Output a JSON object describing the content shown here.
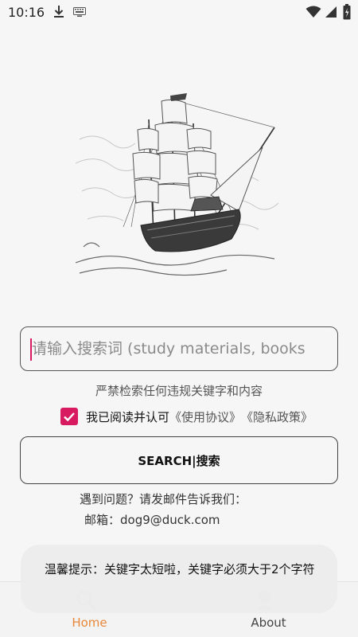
{
  "status_bar": {
    "time": "10:16",
    "icons": [
      "download-icon",
      "keyboard-icon",
      "wifi-icon",
      "signal-icon",
      "battery-icon"
    ]
  },
  "illustration": {
    "subject": "sailing-ship-sketch"
  },
  "search": {
    "placeholder": "请输入搜索词 (study materials, books",
    "value": ""
  },
  "warning_text": "严禁检索任何违规关键字和内容",
  "agreement": {
    "checked": true,
    "text": "我已阅读并认可",
    "terms_link": "《使用协议》",
    "privacy_link": "《隐私政策》"
  },
  "search_button_label": "SEARCH|搜索",
  "help": {
    "line1": "遇到问题？请发邮件告诉我们：",
    "email_line": "邮箱：dog9@duck.com"
  },
  "toast": {
    "message": "温馨提示：关键字太短啦，关键字必须大于2个字符"
  },
  "bottom_nav": {
    "items": [
      {
        "label": "Home",
        "icon": "search-icon",
        "active": true
      },
      {
        "label": "About",
        "icon": "user-icon",
        "active": false
      }
    ]
  },
  "colors": {
    "accent": "#d81b60",
    "nav_active": "#e8883a",
    "background": "#f6f6f6"
  }
}
